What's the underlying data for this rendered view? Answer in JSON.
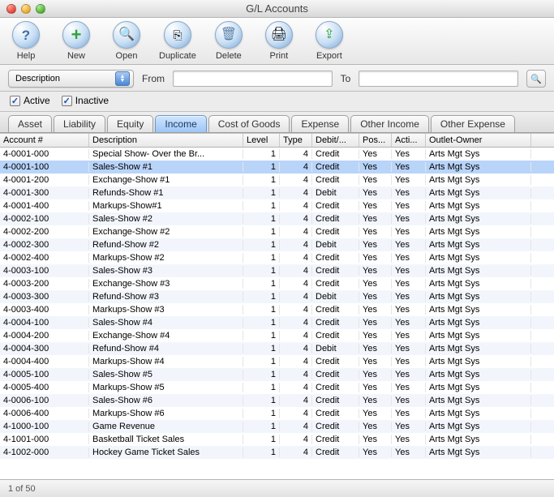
{
  "window": {
    "title": "G/L Accounts"
  },
  "toolbar": {
    "help": {
      "label": "Help"
    },
    "new": {
      "label": "New"
    },
    "open": {
      "label": "Open"
    },
    "duplicate": {
      "label": "Duplicate"
    },
    "delete": {
      "label": "Delete"
    },
    "print": {
      "label": "Print"
    },
    "export": {
      "label": "Export"
    }
  },
  "filter": {
    "field_label": "Description",
    "from_label": "From",
    "to_label": "To",
    "from_value": "",
    "to_value": ""
  },
  "checkboxes": {
    "active_label": "Active",
    "inactive_label": "Inactive",
    "active_checked": true,
    "inactive_checked": true
  },
  "tabs": [
    {
      "label": "Asset",
      "active": false
    },
    {
      "label": "Liability",
      "active": false
    },
    {
      "label": "Equity",
      "active": false
    },
    {
      "label": "Income",
      "active": true
    },
    {
      "label": "Cost of Goods",
      "active": false
    },
    {
      "label": "Expense",
      "active": false
    },
    {
      "label": "Other Income",
      "active": false
    },
    {
      "label": "Other Expense",
      "active": false
    }
  ],
  "columns": [
    "Account #",
    "Description",
    "Level",
    "Type",
    "Debit/...",
    "Pos...",
    "Acti...",
    "Outlet-Owner"
  ],
  "rows": [
    {
      "acct": "4-0001-000",
      "desc": "Special Show- Over the Br...",
      "level": 1,
      "type": 4,
      "dc": "Credit",
      "pos": "Yes",
      "act": "Yes",
      "owner": "Arts Mgt Sys",
      "sel": false
    },
    {
      "acct": "4-0001-100",
      "desc": "Sales-Show #1",
      "level": 1,
      "type": 4,
      "dc": "Credit",
      "pos": "Yes",
      "act": "Yes",
      "owner": "Arts Mgt Sys",
      "sel": true
    },
    {
      "acct": "4-0001-200",
      "desc": "Exchange-Show #1",
      "level": 1,
      "type": 4,
      "dc": "Credit",
      "pos": "Yes",
      "act": "Yes",
      "owner": "Arts Mgt Sys",
      "sel": false
    },
    {
      "acct": "4-0001-300",
      "desc": "Refunds-Show #1",
      "level": 1,
      "type": 4,
      "dc": "Debit",
      "pos": "Yes",
      "act": "Yes",
      "owner": "Arts Mgt Sys",
      "sel": false
    },
    {
      "acct": "4-0001-400",
      "desc": "Markups-Show#1",
      "level": 1,
      "type": 4,
      "dc": "Credit",
      "pos": "Yes",
      "act": "Yes",
      "owner": "Arts Mgt Sys",
      "sel": false
    },
    {
      "acct": "4-0002-100",
      "desc": "Sales-Show #2",
      "level": 1,
      "type": 4,
      "dc": "Credit",
      "pos": "Yes",
      "act": "Yes",
      "owner": "Arts Mgt Sys",
      "sel": false
    },
    {
      "acct": "4-0002-200",
      "desc": "Exchange-Show #2",
      "level": 1,
      "type": 4,
      "dc": "Credit",
      "pos": "Yes",
      "act": "Yes",
      "owner": "Arts Mgt Sys",
      "sel": false
    },
    {
      "acct": "4-0002-300",
      "desc": "Refund-Show #2",
      "level": 1,
      "type": 4,
      "dc": "Debit",
      "pos": "Yes",
      "act": "Yes",
      "owner": "Arts Mgt Sys",
      "sel": false
    },
    {
      "acct": "4-0002-400",
      "desc": "Markups-Show #2",
      "level": 1,
      "type": 4,
      "dc": "Credit",
      "pos": "Yes",
      "act": "Yes",
      "owner": "Arts Mgt Sys",
      "sel": false
    },
    {
      "acct": "4-0003-100",
      "desc": "Sales-Show #3",
      "level": 1,
      "type": 4,
      "dc": "Credit",
      "pos": "Yes",
      "act": "Yes",
      "owner": "Arts Mgt Sys",
      "sel": false
    },
    {
      "acct": "4-0003-200",
      "desc": "Exchange-Show #3",
      "level": 1,
      "type": 4,
      "dc": "Credit",
      "pos": "Yes",
      "act": "Yes",
      "owner": "Arts Mgt Sys",
      "sel": false
    },
    {
      "acct": "4-0003-300",
      "desc": "Refund-Show #3",
      "level": 1,
      "type": 4,
      "dc": "Debit",
      "pos": "Yes",
      "act": "Yes",
      "owner": "Arts Mgt Sys",
      "sel": false
    },
    {
      "acct": "4-0003-400",
      "desc": "Markups-Show #3",
      "level": 1,
      "type": 4,
      "dc": "Credit",
      "pos": "Yes",
      "act": "Yes",
      "owner": "Arts Mgt Sys",
      "sel": false
    },
    {
      "acct": "4-0004-100",
      "desc": "Sales-Show #4",
      "level": 1,
      "type": 4,
      "dc": "Credit",
      "pos": "Yes",
      "act": "Yes",
      "owner": "Arts Mgt Sys",
      "sel": false
    },
    {
      "acct": "4-0004-200",
      "desc": "Exchange-Show #4",
      "level": 1,
      "type": 4,
      "dc": "Credit",
      "pos": "Yes",
      "act": "Yes",
      "owner": "Arts Mgt Sys",
      "sel": false
    },
    {
      "acct": "4-0004-300",
      "desc": "Refund-Show #4",
      "level": 1,
      "type": 4,
      "dc": "Debit",
      "pos": "Yes",
      "act": "Yes",
      "owner": "Arts Mgt Sys",
      "sel": false
    },
    {
      "acct": "4-0004-400",
      "desc": "Markups-Show #4",
      "level": 1,
      "type": 4,
      "dc": "Credit",
      "pos": "Yes",
      "act": "Yes",
      "owner": "Arts Mgt Sys",
      "sel": false
    },
    {
      "acct": "4-0005-100",
      "desc": "Sales-Show #5",
      "level": 1,
      "type": 4,
      "dc": "Credit",
      "pos": "Yes",
      "act": "Yes",
      "owner": "Arts Mgt Sys",
      "sel": false
    },
    {
      "acct": "4-0005-400",
      "desc": "Markups-Show #5",
      "level": 1,
      "type": 4,
      "dc": "Credit",
      "pos": "Yes",
      "act": "Yes",
      "owner": "Arts Mgt Sys",
      "sel": false
    },
    {
      "acct": "4-0006-100",
      "desc": "Sales-Show #6",
      "level": 1,
      "type": 4,
      "dc": "Credit",
      "pos": "Yes",
      "act": "Yes",
      "owner": "Arts Mgt Sys",
      "sel": false
    },
    {
      "acct": "4-0006-400",
      "desc": "Markups-Show #6",
      "level": 1,
      "type": 4,
      "dc": "Credit",
      "pos": "Yes",
      "act": "Yes",
      "owner": "Arts Mgt Sys",
      "sel": false
    },
    {
      "acct": "4-1000-100",
      "desc": "Game Revenue",
      "level": 1,
      "type": 4,
      "dc": "Credit",
      "pos": "Yes",
      "act": "Yes",
      "owner": "Arts Mgt Sys",
      "sel": false
    },
    {
      "acct": "4-1001-000",
      "desc": "Basketball Ticket Sales",
      "level": 1,
      "type": 4,
      "dc": "Credit",
      "pos": "Yes",
      "act": "Yes",
      "owner": "Arts Mgt Sys",
      "sel": false
    },
    {
      "acct": "4-1002-000",
      "desc": "Hockey Game Ticket Sales",
      "level": 1,
      "type": 4,
      "dc": "Credit",
      "pos": "Yes",
      "act": "Yes",
      "owner": "Arts Mgt Sys",
      "sel": false
    }
  ],
  "status": {
    "text": "1 of 50"
  }
}
